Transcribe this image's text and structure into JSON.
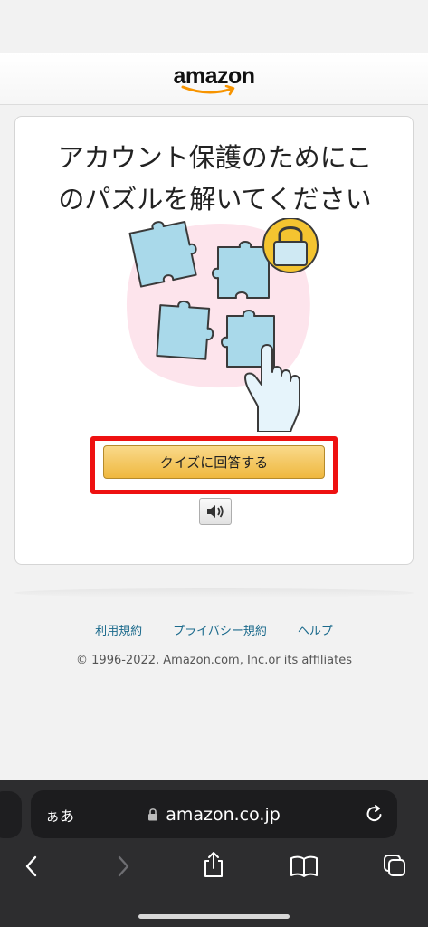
{
  "header": {
    "logo_text": "amazon"
  },
  "card": {
    "title_line1": "アカウント保護のためにこ",
    "title_line2": "のパズルを解いてください",
    "quiz_button_label": "クイズに回答する",
    "audio_icon": "speaker-icon"
  },
  "footer": {
    "links": [
      "利用規約",
      "プライバシー規約",
      "ヘルプ"
    ],
    "copyright": "© 1996-2022, Amazon.com, Inc.or its affiliates"
  },
  "browser": {
    "text_size_label": "ぁあ",
    "url": "amazon.co.jp",
    "icons": [
      "lock-icon",
      "reload-icon",
      "back-icon",
      "forward-icon",
      "share-icon",
      "bookmarks-icon",
      "tabs-icon"
    ]
  },
  "colors": {
    "accent_button": "#f0c14b",
    "highlight_border": "#ee1111",
    "link": "#1b6a8c",
    "amazon_smile": "#f79400"
  }
}
